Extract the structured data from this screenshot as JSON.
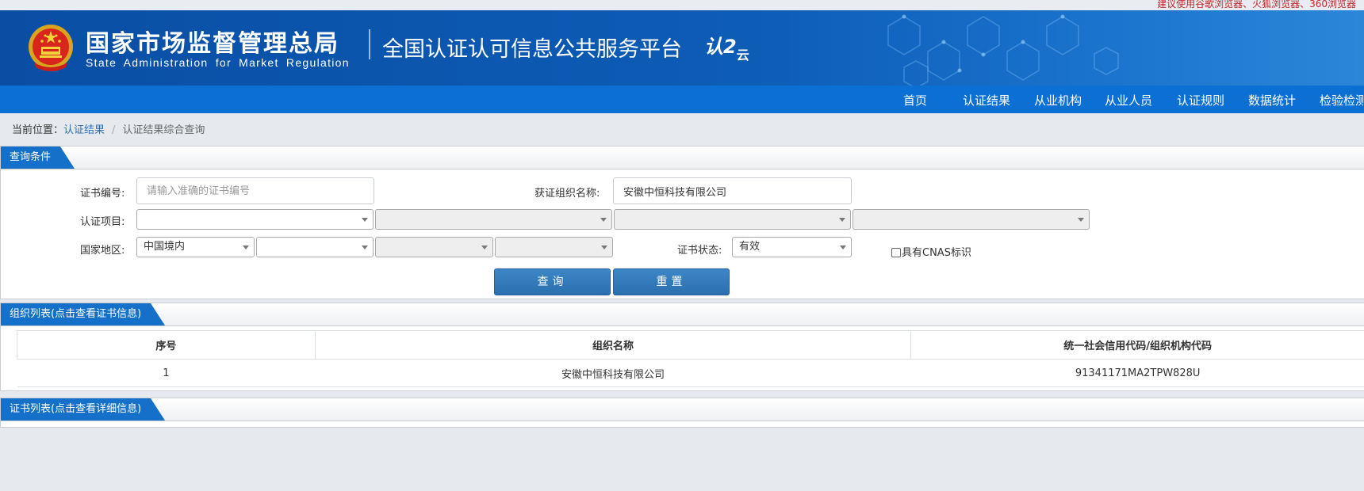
{
  "browser_tip": "建议使用谷歌浏览器、火狐浏览器、360浏览器",
  "header": {
    "agency_cn": "国家市场监督管理总局",
    "agency_en": "State Administration for Market Regulation",
    "platform_title": "全国认证认可信息公共服务平台",
    "cloud_logo_main": "认",
    "cloud_logo_sub": "云",
    "emblem": "national-emblem-icon"
  },
  "nav": {
    "items": [
      "首页",
      "认证结果",
      "从业机构",
      "从业人员",
      "认证规则",
      "数据统计",
      "检验检测"
    ]
  },
  "breadcrumb": {
    "prefix": "当前位置：",
    "link": "认证结果",
    "separator": "/",
    "current": "认证结果综合查询"
  },
  "query": {
    "panel_title": "查询条件",
    "cert_no_label": "证书编号:",
    "cert_no_placeholder": "请输入准确的证书编号",
    "cert_no_value": "",
    "org_name_label": "获证组织名称:",
    "org_name_value": "安徽中恒科技有限公司",
    "project_label": "认证项目:",
    "region_label": "国家地区:",
    "region_value": "中国境内",
    "status_label": "证书状态:",
    "status_value": "有效",
    "cnas_label": "具有CNAS标识",
    "search_button": "查询",
    "reset_button": "重置"
  },
  "org_list": {
    "panel_title": "组织列表(点击查看证书信息)",
    "columns": [
      "序号",
      "组织名称",
      "统一社会信用代码/组织机构代码"
    ],
    "rows": [
      [
        "1",
        "安徽中恒科技有限公司",
        "91341171MA2TPW828U"
      ]
    ]
  },
  "cert_list": {
    "panel_title": "证书列表(点击查看详细信息)"
  },
  "colors": {
    "header_blue": "#0d5cb6",
    "nav_blue": "#0b6fd4",
    "panel_tab_blue": "#1470c8",
    "button_blue": "#3377b8",
    "breadcrumb_link": "#2a6fb6",
    "tip_red": "#c0282d"
  }
}
